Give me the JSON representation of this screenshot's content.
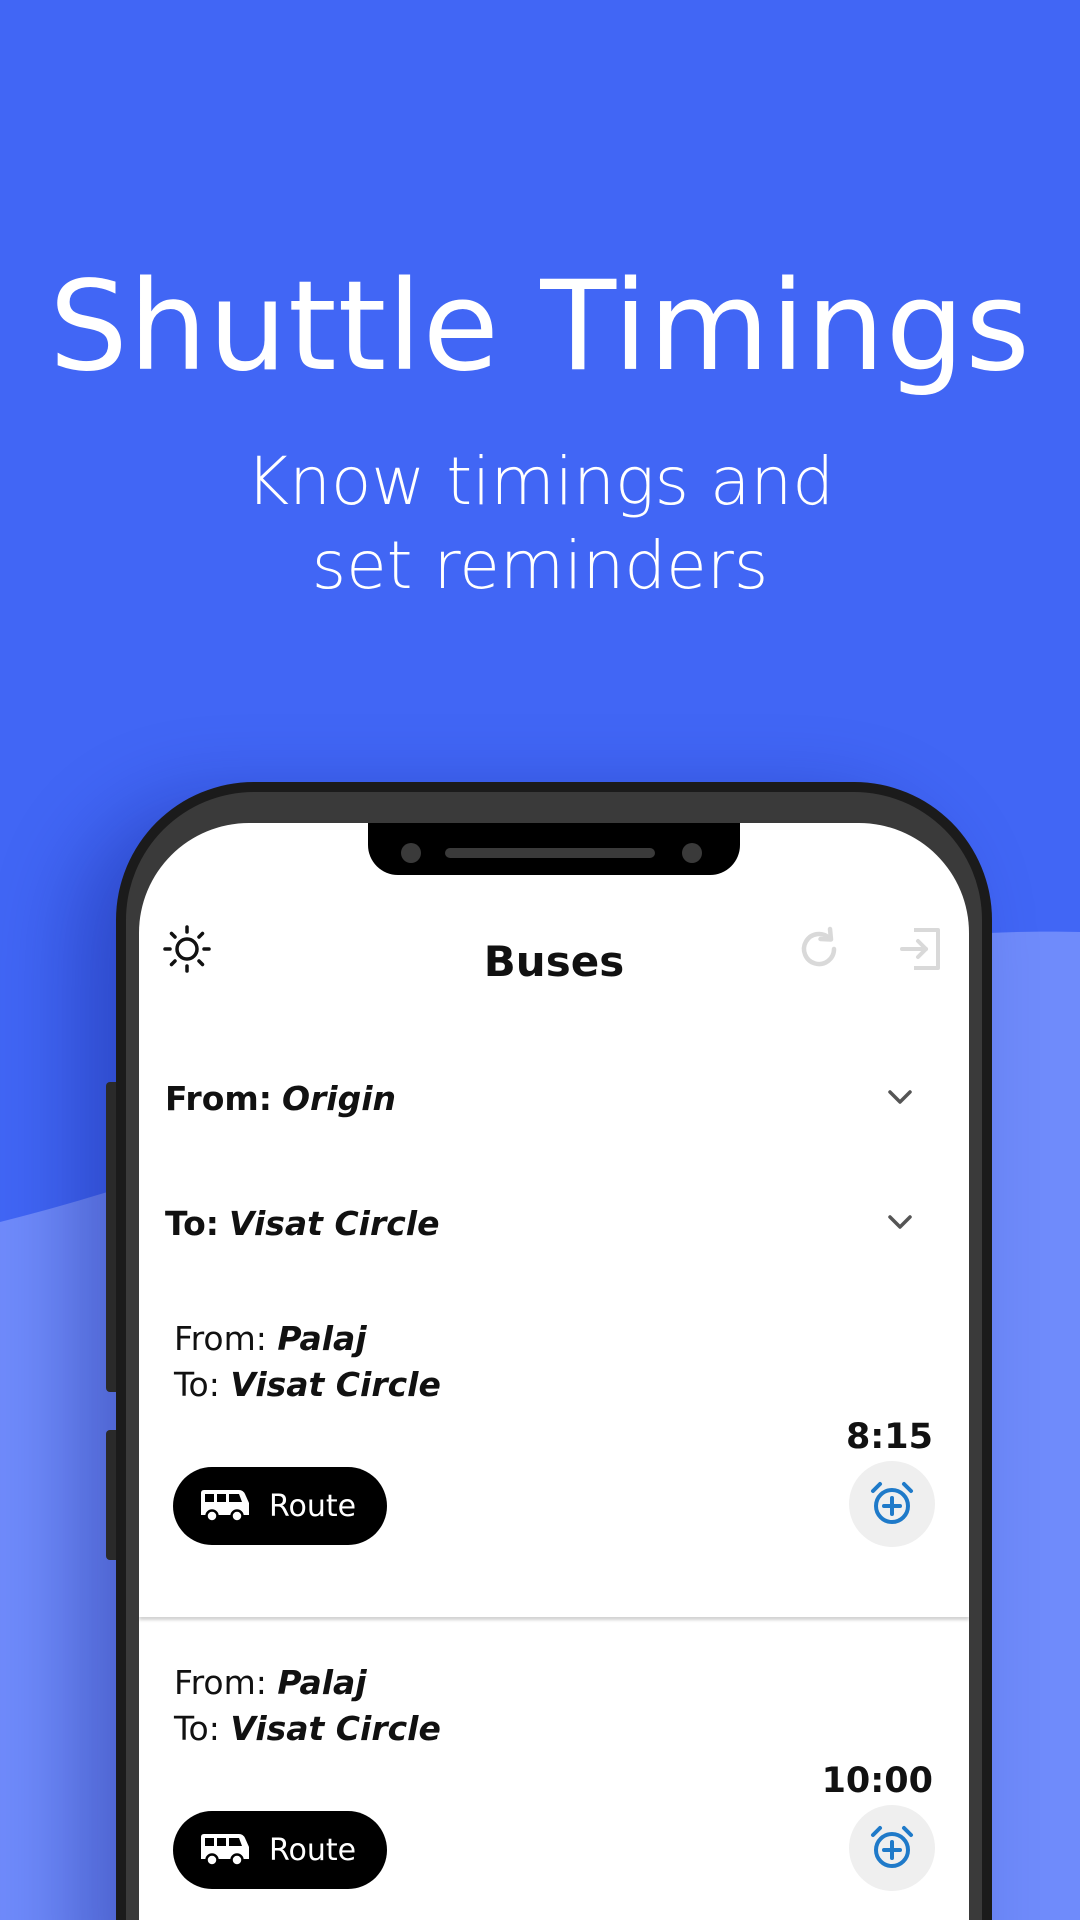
{
  "promo": {
    "headline": "Shuttle Timings",
    "subline_1": "Know timings and",
    "subline_2": "set reminders"
  },
  "colors": {
    "background": "#4166f5",
    "wave": "#6f8bfb",
    "accent_icon": "#1f7ac9"
  },
  "app": {
    "title": "Buses",
    "icons": {
      "theme": "sun-icon",
      "refresh": "refresh-icon",
      "logout": "logout-icon"
    },
    "from_selector": {
      "label": "From:",
      "value": "Origin"
    },
    "to_selector": {
      "label": "To:",
      "value": "Visat Circle"
    },
    "trips": [
      {
        "from_label": "From:",
        "from_value": "Palaj",
        "to_label": "To:",
        "to_value": "Visat Circle",
        "time": "8:15",
        "route_label": "Route"
      },
      {
        "from_label": "From:",
        "from_value": "Palaj",
        "to_label": "To:",
        "to_value": "Visat Circle",
        "time": "10:00",
        "route_label": "Route"
      }
    ]
  }
}
